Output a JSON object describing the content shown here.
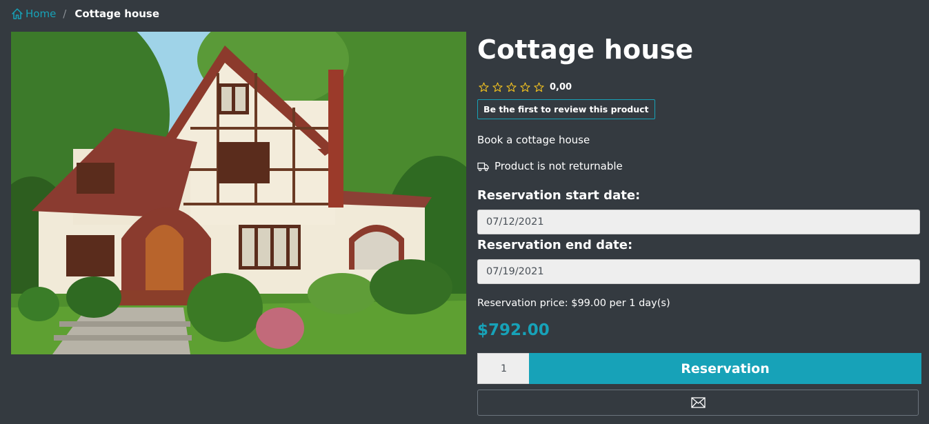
{
  "breadcrumb": {
    "home_label": "Home",
    "separator": "/",
    "current": "Cottage house"
  },
  "product": {
    "title": "Cottage house",
    "rating": {
      "stars": 0,
      "max_stars": 5,
      "value_text": "0,00"
    },
    "review_button_label": "Be the first to review this product",
    "short_description": "Book a cottage house",
    "returnable_text": "Product is not returnable",
    "image_description_icon": "truck-icon"
  },
  "reservation": {
    "start_label": "Reservation start date:",
    "start_value": "07/12/2021",
    "end_label": "Reservation end date:",
    "end_value": "07/19/2021",
    "price_label": "Reservation price: $99.00 per 1 day(s)",
    "total_price": "$792.00",
    "quantity": "1",
    "button_label": "Reservation"
  },
  "colors": {
    "background": "#343a40",
    "accent": "#17a2b8",
    "star": "#f0c020"
  }
}
